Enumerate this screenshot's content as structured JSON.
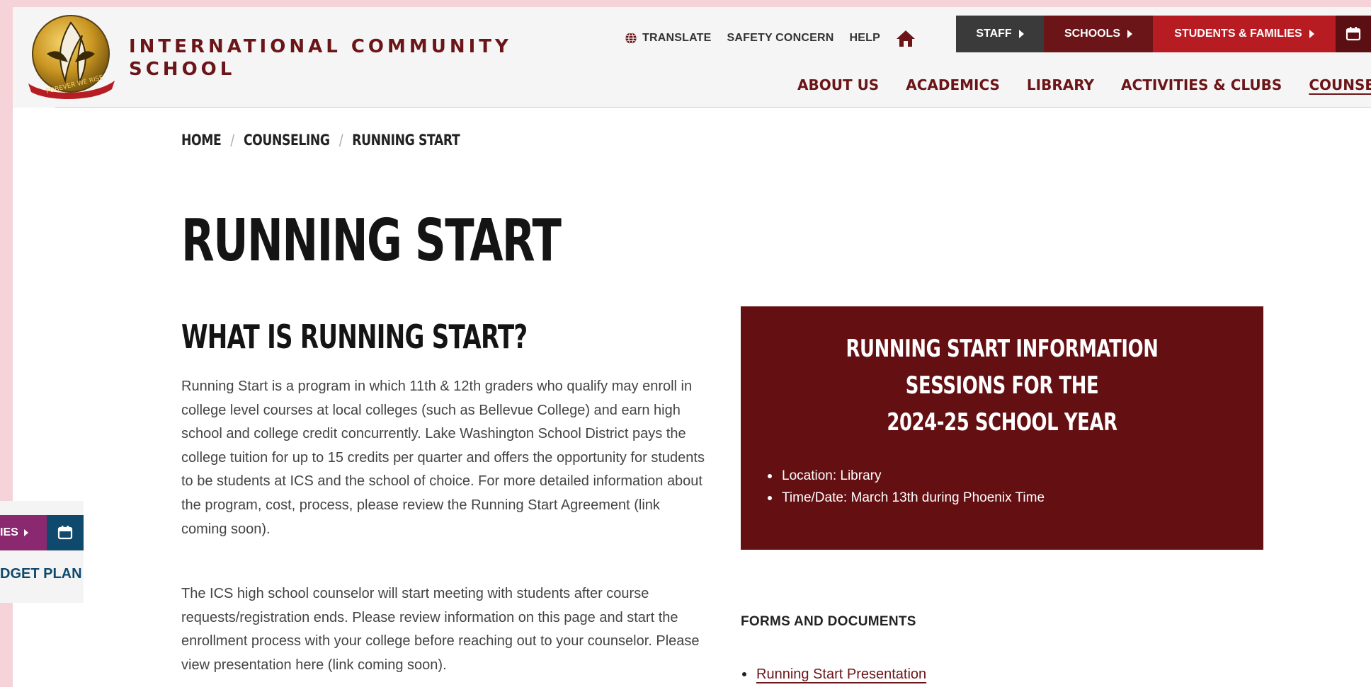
{
  "header": {
    "school_name_line1": "INTERNATIONAL COMMUNITY",
    "school_name_line2": "SCHOOL",
    "logo_motto": "FOREVER WE RISE",
    "utility_links": [
      "TRANSLATE",
      "SAFETY CONCERN",
      "HELP"
    ],
    "portal_buttons": [
      "STAFF",
      "SCHOOLS",
      "STUDENTS & FAMILIES"
    ],
    "main_nav": [
      "ABOUT US",
      "ACADEMICS",
      "LIBRARY",
      "ACTIVITIES & CLUBS",
      "COUNSELING"
    ],
    "active_nav": "COUNSELING",
    "colors": {
      "brand": "#6b1518",
      "staff": "#3a3a3a",
      "students": "#b71c22",
      "box": "#641013"
    }
  },
  "breadcrumb": [
    "HOME",
    "COUNSELING",
    "RUNNING START"
  ],
  "page": {
    "title": "RUNNING START",
    "section_title": "WHAT IS RUNNING START?",
    "paragraph1": "Running Start is a program in which 11th & 12th graders who qualify may enroll in college level courses at local colleges (such as Bellevue College) and earn high school and college credit concurrently. Lake Washington School District pays the college tuition for up to 15 credits per quarter and offers the opportunity for students to be students at ICS and the school of choice. For more detailed information about the program, cost, process, please review the Running Start Agreement (link coming soon).",
    "paragraph2": "The ICS high school counselor will start meeting with students after course requests/registration ends. Please review information on this page and start the enrollment process with your college before reaching out to your counselor.  Please view presentation here (link coming soon)."
  },
  "info_box": {
    "title_line1": "RUNNING START INFORMATION SESSIONS FOR THE",
    "title_line2": "2024-25 SCHOOL YEAR",
    "items": [
      "Location: Library",
      "Time/Date: March 13th during Phoenix Time"
    ]
  },
  "forms": {
    "heading": "FORMS AND DOCUMENTS",
    "links": [
      "Running Start Presentation"
    ]
  },
  "fragment": {
    "button_partial": "IES",
    "link_partial": "DGET PLAN"
  }
}
